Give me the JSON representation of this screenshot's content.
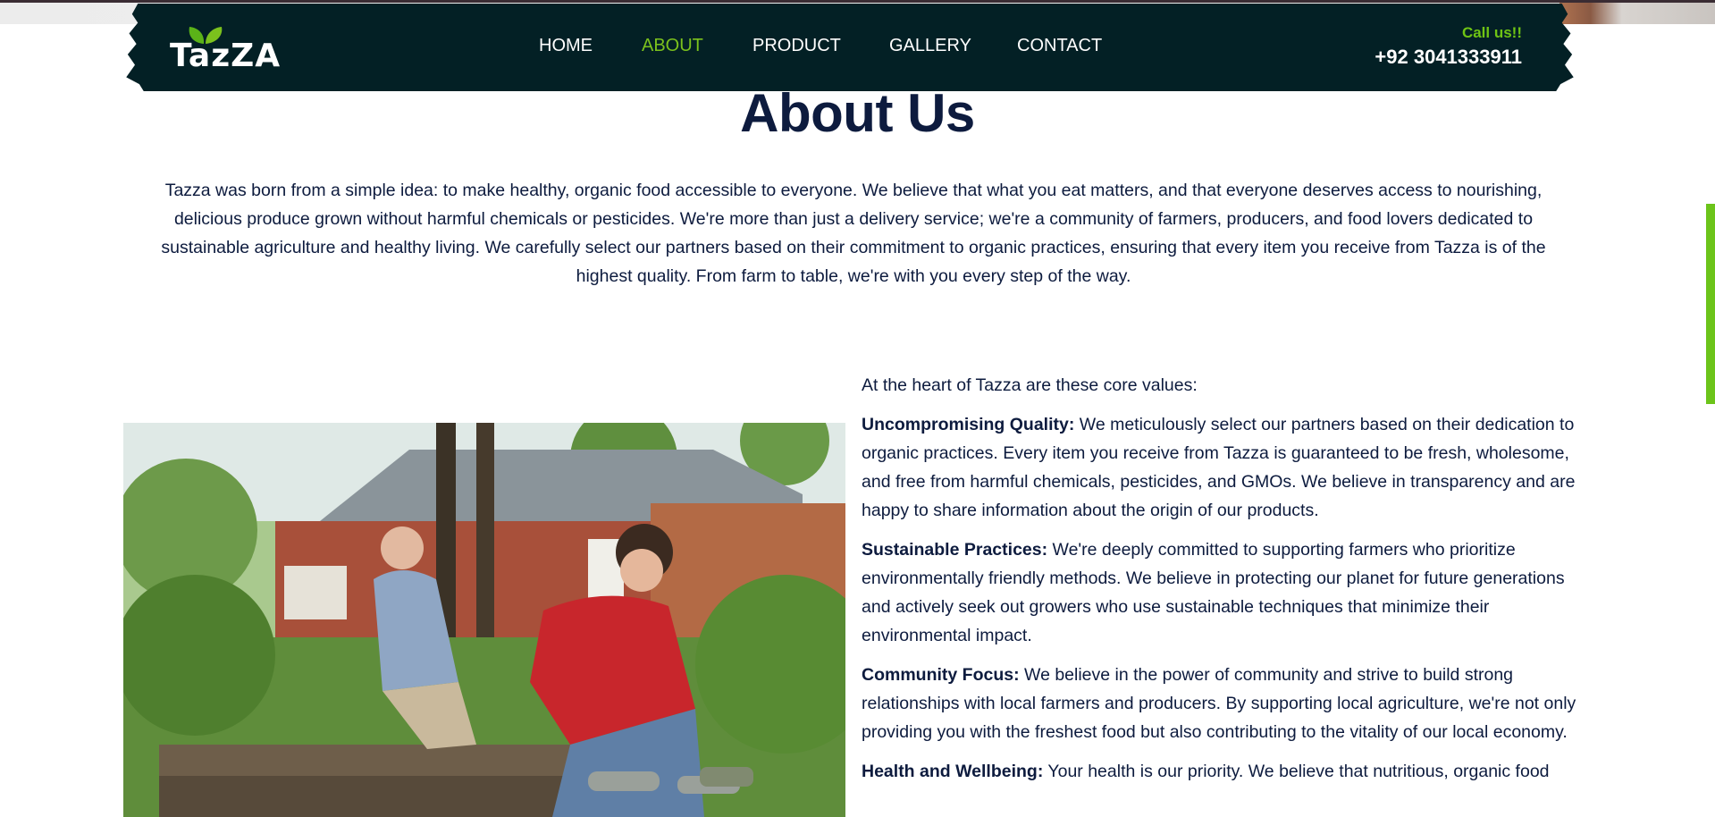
{
  "brand": {
    "logo_text": "TazZA"
  },
  "nav": {
    "items": [
      {
        "label": "HOME",
        "active": false
      },
      {
        "label": "ABOUT",
        "active": true
      },
      {
        "label": "PRODUCT",
        "active": false
      },
      {
        "label": "GALLERY",
        "active": false
      },
      {
        "label": "CONTACT",
        "active": false
      }
    ]
  },
  "contact": {
    "call_label": "Call us!!",
    "phone": "+92 3041333911"
  },
  "about": {
    "title": "About Us",
    "intro": "Tazza was born from a simple idea: to make healthy, organic food accessible to everyone. We believe that what you eat matters, and that everyone deserves access to nourishing, delicious produce grown without harmful chemicals or pesticides. We're more than just a delivery service; we're a community of farmers, producers, and food lovers dedicated to sustainable agriculture and healthy living. We carefully select our partners based on their commitment to organic practices, ensuring that every item you receive from Tazza is of the highest quality. From farm to table, we're with you every step of the way."
  },
  "values": {
    "heading": "At the heart of Tazza are these core values:",
    "items": [
      {
        "title": "Uncompromising Quality:",
        "text": " We meticulously select our partners based on their dedication to organic practices. Every item you receive from Tazza is guaranteed to be fresh, wholesome, and free from harmful chemicals, pesticides, and GMOs. We believe in transparency and are happy to share information about the origin of our products."
      },
      {
        "title": "Sustainable Practices:",
        "text": " We're deeply committed to supporting farmers who prioritize environmentally friendly methods. We believe in protecting our planet for future generations and actively seek out growers who use sustainable techniques that minimize their environmental impact."
      },
      {
        "title": "Community Focus:",
        "text": " We believe in the power of community and strive to build strong relationships with local farmers and producers. By supporting local agriculture, we're not only providing you with the freshest food but also contributing to the vitality of our local economy."
      },
      {
        "title": "Health and Wellbeing:",
        "text": " Your health is our priority. We believe that nutritious, organic food"
      }
    ]
  },
  "colors": {
    "nav_bg": "#032025",
    "accent_green": "#7bc11d",
    "text_navy": "#0d1b3e"
  }
}
